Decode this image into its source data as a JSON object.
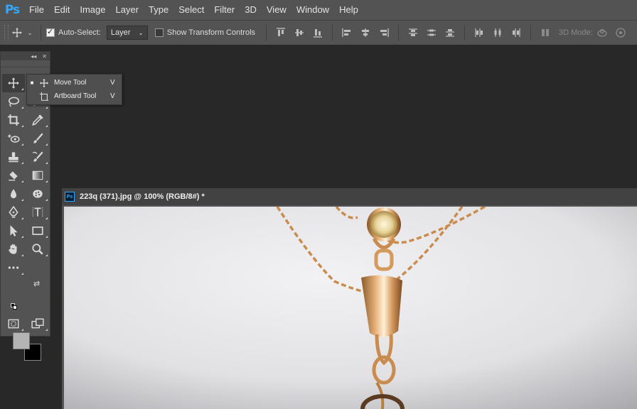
{
  "app": {
    "logo": "Ps"
  },
  "menu": {
    "items": [
      "File",
      "Edit",
      "Image",
      "Layer",
      "Type",
      "Select",
      "Filter",
      "3D",
      "View",
      "Window",
      "Help"
    ]
  },
  "options": {
    "auto_select_label": "Auto-Select:",
    "auto_select_checked": true,
    "layer_select_value": "Layer",
    "show_transform_label": "Show Transform Controls",
    "show_transform_checked": false,
    "mode_3d_label": "3D Mode:",
    "align_icons": [
      "align-top-icon",
      "align-vcenter-icon",
      "align-bottom-icon",
      "align-left-icon",
      "align-hcenter-icon",
      "align-right-icon",
      "distribute-top-icon",
      "distribute-vcenter-icon",
      "distribute-bottom-icon",
      "distribute-left-icon",
      "distribute-hcenter-icon",
      "distribute-right-icon",
      "auto-align-icon"
    ]
  },
  "flyout": {
    "items": [
      {
        "label": "Move Tool",
        "shortcut": "V",
        "icon": "move-icon",
        "selected": true
      },
      {
        "label": "Artboard Tool",
        "shortcut": "V",
        "icon": "artboard-icon",
        "selected": false
      }
    ]
  },
  "tools": [
    "move-tool",
    "lasso-tool",
    "crop-tool",
    "eyedropper-tool",
    "spot-healing-tool",
    "brush-tool",
    "clone-stamp-tool",
    "history-brush-tool",
    "eraser-tool",
    "gradient-tool",
    "blur-tool",
    "dodge-tool",
    "pen-tool",
    "type-tool",
    "path-selection-tool",
    "rectangle-tool",
    "hand-tool",
    "zoom-tool",
    "edit-toolbar-tool"
  ],
  "colors": {
    "foreground": "#b4b4b4",
    "background": "#000000",
    "accent": "#31a8ff"
  },
  "document": {
    "title": "223q (371).jpg @ 100% (RGB/8#) *",
    "badge": "Ps"
  }
}
